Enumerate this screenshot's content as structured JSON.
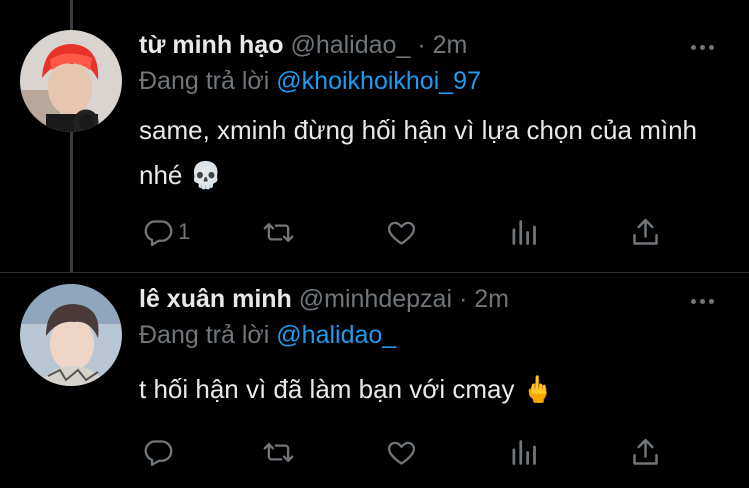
{
  "tweets": [
    {
      "author_name": "từ minh hạo",
      "handle": "@halidao_",
      "separator": "·",
      "time": "2m",
      "reply_prefix": "Đang trả lời",
      "reply_to": "@khoikhoikhoi_97",
      "text": "same, xminh đừng hối hận vì lựa chọn của mình nhé 💀",
      "actions": {
        "reply_count": "1",
        "retweet_count": "",
        "like_count": ""
      },
      "avatar_colors": {
        "hair": "#e8332a",
        "skin": "#e7c6b0",
        "bg": "#d9d4cf"
      }
    },
    {
      "author_name": "lê xuân minh",
      "handle": "@minhdepzai",
      "separator": "·",
      "time": "2m",
      "reply_prefix": "Đang trả lời",
      "reply_to": "@halidao_",
      "text": "t hối hận vì đã làm bạn với cmay 🖕",
      "actions": {
        "reply_count": "",
        "retweet_count": "",
        "like_count": ""
      },
      "avatar_colors": {
        "hair": "#4a3a3a",
        "skin": "#efd5c6",
        "bg": "#b9c6d3"
      }
    }
  ],
  "icons": [
    "reply-icon",
    "retweet-icon",
    "like-icon",
    "analytics-icon",
    "share-icon",
    "more-icon"
  ],
  "colors": {
    "background": "#000000",
    "text": "#e7e9ea",
    "muted": "#71767b",
    "link": "#1d9bf0",
    "thread_line": "#3a3d40"
  }
}
